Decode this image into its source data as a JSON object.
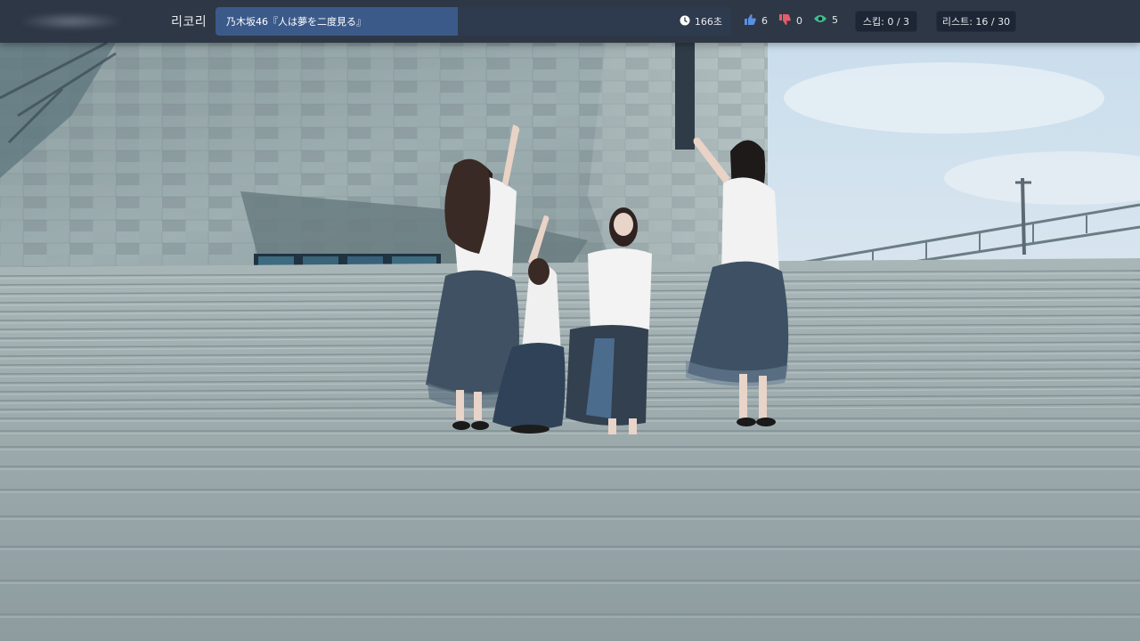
{
  "header": {
    "brand": "리코리",
    "song_title": "乃木坂46『人は夢を二度見る』",
    "timer": "166초",
    "title_progress": 0.47,
    "likes": "6",
    "dislikes": "0",
    "views": "5",
    "skip": "스킵: 0 / 3",
    "list": "리스트: 16 / 30"
  },
  "icons": {
    "timer": "clock-icon",
    "likes": "thumbs-up-icon",
    "dislikes": "thumbs-down-icon",
    "views": "eye-icon"
  },
  "colors": {
    "topbar_bg": "#222a38",
    "title_progress": "#3b5a8a",
    "like_icon": "#5b8fe0",
    "dislike_icon": "#e35d6a",
    "view_icon": "#3fbf8e"
  }
}
